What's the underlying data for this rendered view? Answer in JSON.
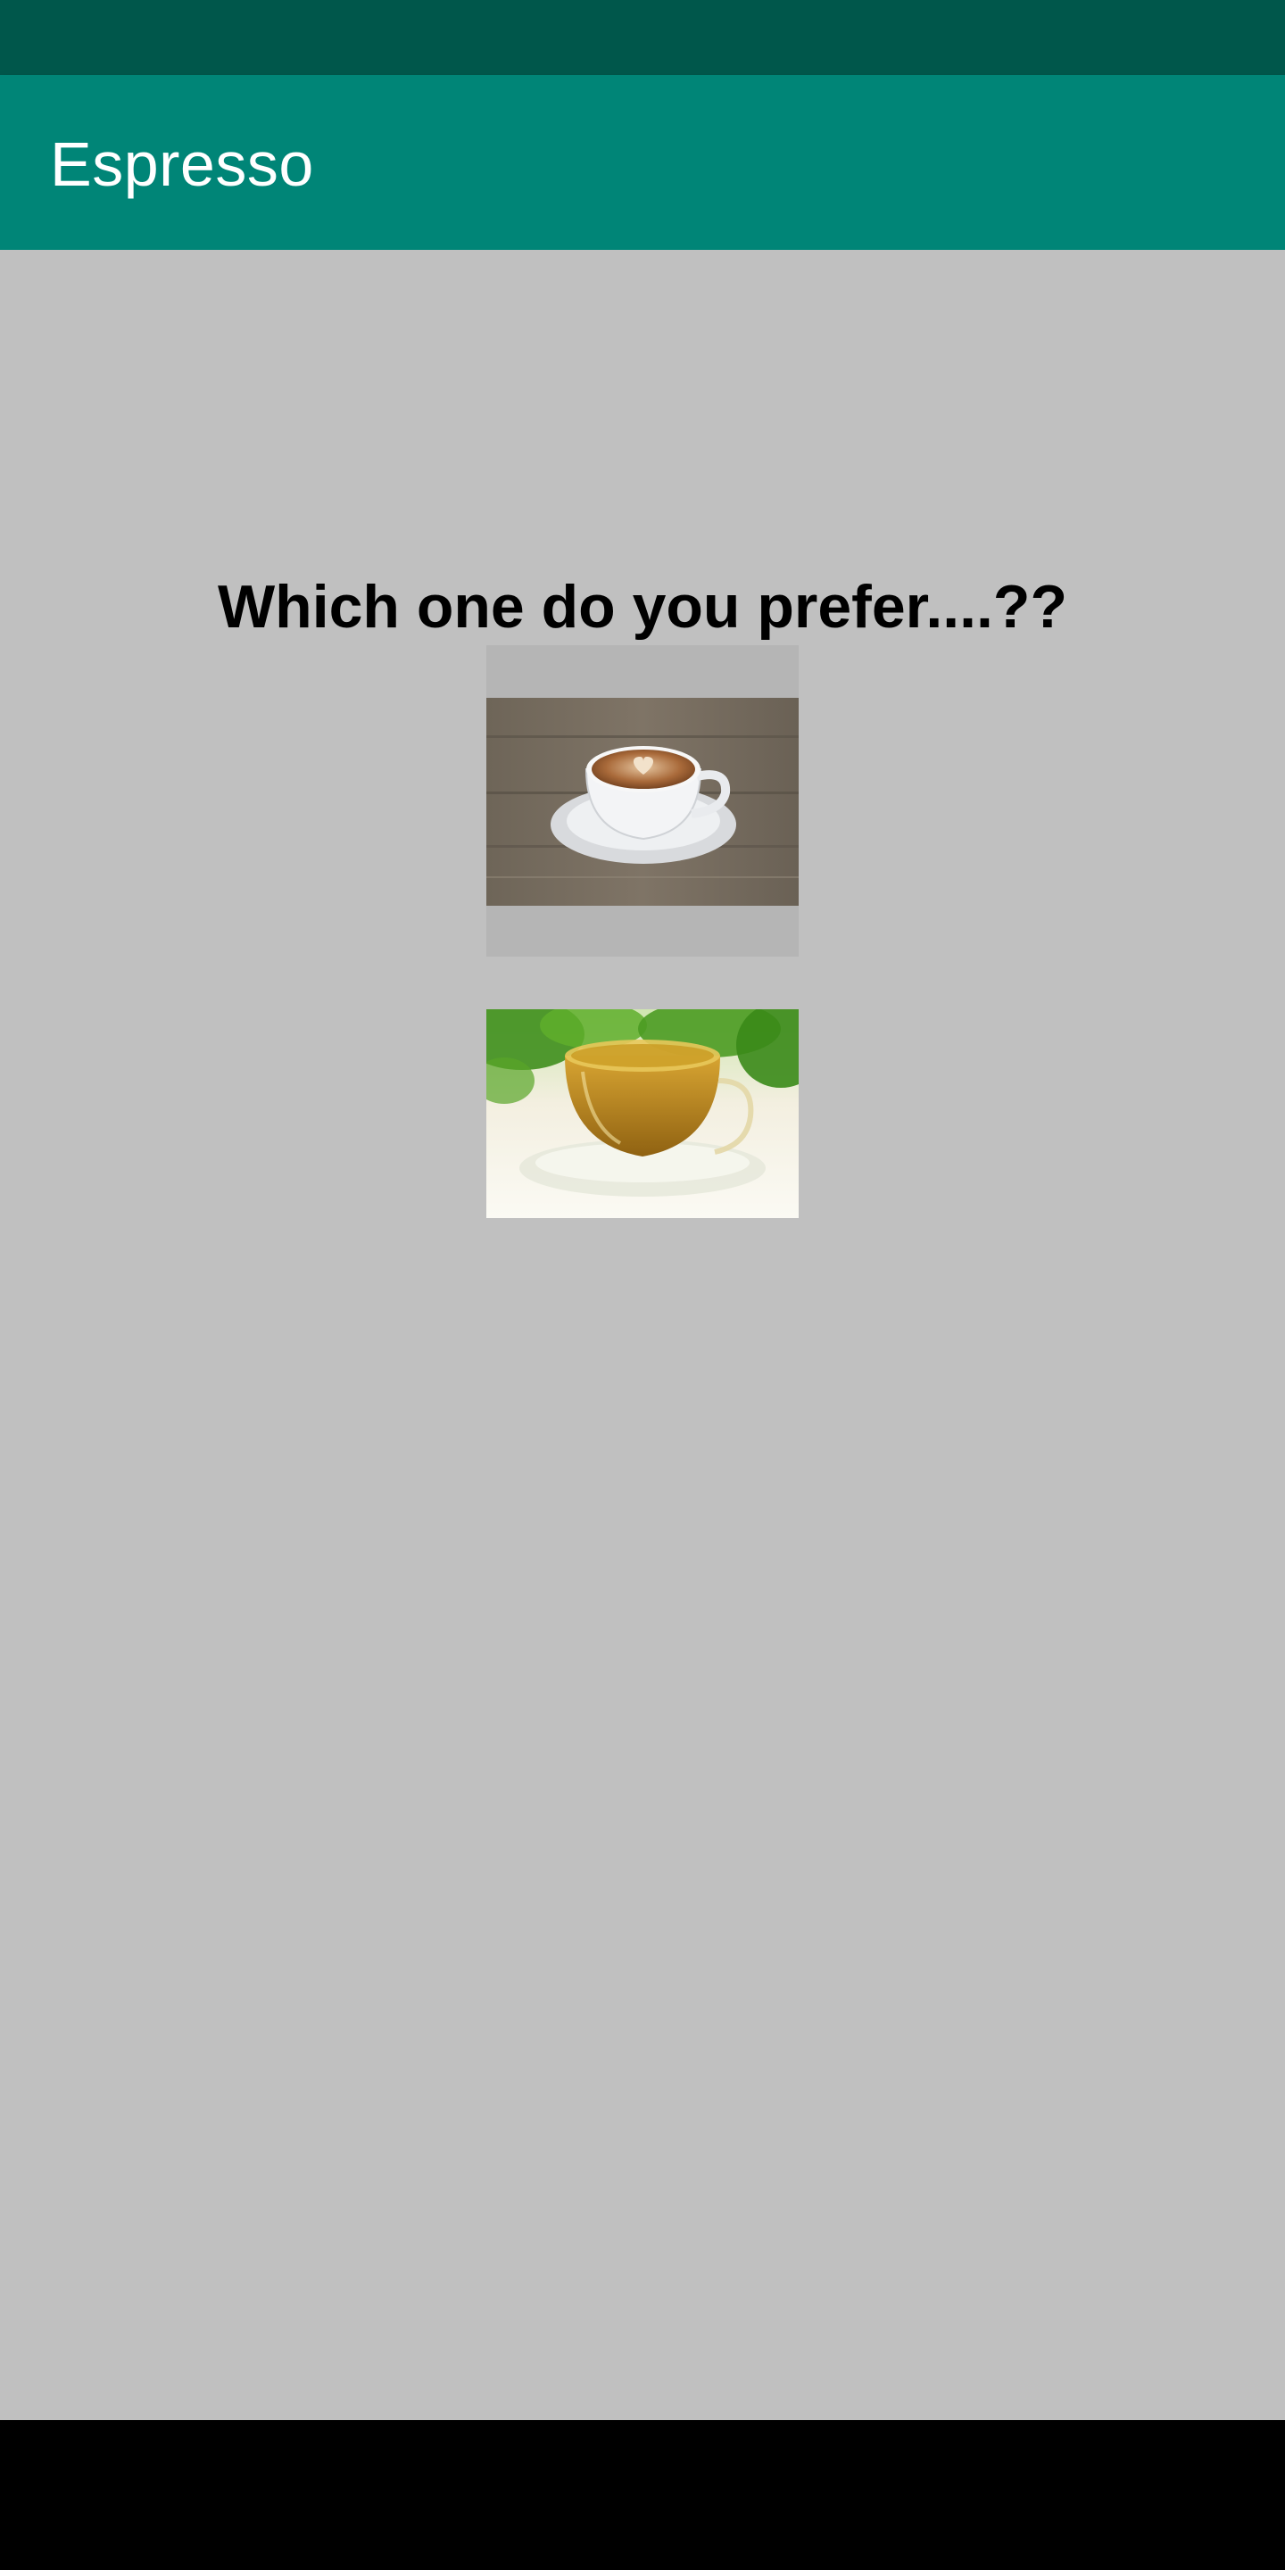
{
  "app_bar": {
    "title": "Espresso",
    "color": "#008577"
  },
  "status_bar": {
    "color": "#00574b"
  },
  "main": {
    "question": "Which one do you prefer....??",
    "choices": [
      {
        "name": "coffee",
        "icon": "latte-cup-image"
      },
      {
        "name": "tea",
        "icon": "tea-cup-image"
      }
    ]
  },
  "navigation_bar": {
    "color": "#000000"
  }
}
